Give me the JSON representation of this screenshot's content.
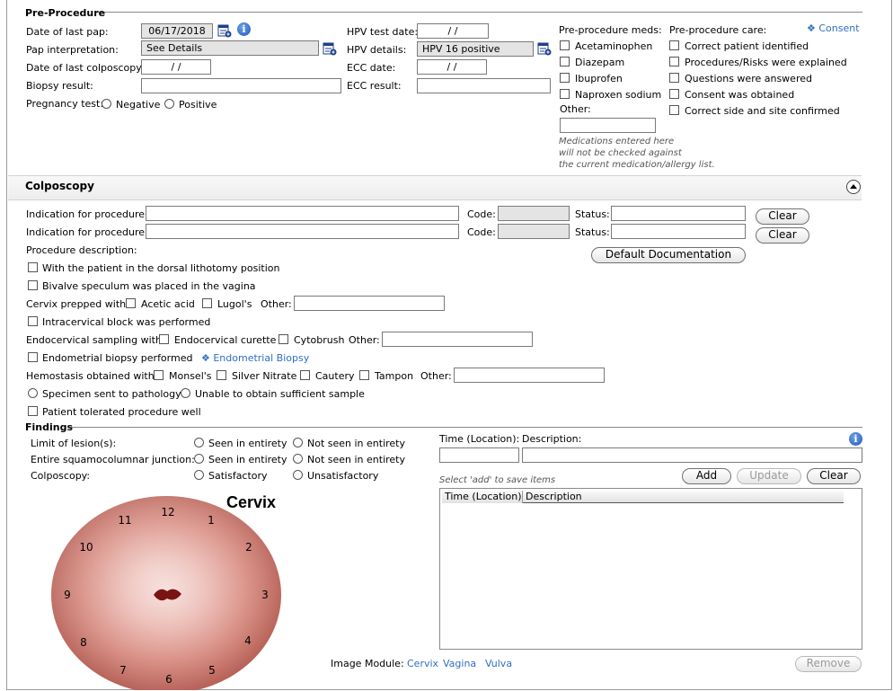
{
  "pre_procedure": {
    "title": "Pre-Procedure",
    "date_last_pap_label": "Date of last pap:",
    "date_last_pap_value": "06/17/2018",
    "pap_interp_label": "Pap interpretation:",
    "pap_interp_value": "See Details",
    "date_last_colpo_label": "Date of last colposcopy:",
    "date_last_colpo_value": "/ /",
    "biopsy_result_label": "Biopsy result:",
    "biopsy_result_value": "",
    "pregnancy_test_label": "Pregnancy test:",
    "negative_label": "Negative",
    "positive_label": "Positive",
    "hpv_test_date_label": "HPV test date:",
    "hpv_test_date_value": "/ /",
    "hpv_details_label": "HPV details:",
    "hpv_details_value": "HPV 16 positive",
    "ecc_date_label": "ECC date:",
    "ecc_date_value": "/ /",
    "ecc_result_label": "ECC result:",
    "ecc_result_value": "",
    "meds_label": "Pre-procedure meds:",
    "meds": [
      "Acetaminophen",
      "Diazepam",
      "Ibuprofen",
      "Naproxen sodium"
    ],
    "other_label": "Other:",
    "other_value": "",
    "meds_note": "Medications entered here\nwill not be checked against\nthe current medication/allergy list.",
    "care_label": "Pre-procedure care:",
    "consent_link": "Consent",
    "care": [
      "Correct patient identified",
      "Procedures/Risks were explained",
      "Questions were answered",
      "Consent was obtained",
      "Correct side and site confirmed"
    ]
  },
  "colposcopy": {
    "title": "Colposcopy",
    "indication_label": "Indication for procedure:",
    "code_label": "Code:",
    "status_label": "Status:",
    "clear_label": "Clear",
    "procedure_description_label": "Procedure description:",
    "default_doc_label": "Default Documentation",
    "dorsal": "With the patient in the dorsal lithotomy position",
    "bivalve": "Bivalve speculum was placed in the vagina",
    "cervix_prepped_label": "Cervix prepped with:",
    "acetic": "Acetic acid",
    "lugols": "Lugol's",
    "other_label": "Other:",
    "intracervical": "Intracervical block was performed",
    "endo_sampling_label": "Endocervical sampling with:",
    "endo_curette": "Endocervical curette",
    "cytobrush": "Cytobrush",
    "endometrial_biopsy": "Endometrial biopsy performed",
    "endometrial_link": "Endometrial Biopsy",
    "hemostasis_label": "Hemostasis obtained with:",
    "monsels": "Monsel's",
    "silver_nitrate": "Silver Nitrate",
    "cautery": "Cautery",
    "tampon": "Tampon",
    "specimen": "Specimen sent to pathology",
    "unable": "Unable to obtain sufficient sample",
    "tolerated": "Patient tolerated procedure well"
  },
  "findings": {
    "title": "Findings",
    "limit_label": "Limit of lesion(s):",
    "squamo_label": "Entire squamocolumnar junction:",
    "colposcopy_label": "Colposcopy:",
    "seen": "Seen in entirety",
    "not_seen": "Not seen in entirety",
    "satisfactory": "Satisfactory",
    "unsatisfactory": "Unsatisfactory",
    "time_location_label": "Time (Location):",
    "description_label": "Description:",
    "hint": "Select 'add' to save items",
    "add_label": "Add",
    "update_label": "Update",
    "clear_label": "Clear",
    "col_time": "Time (Location)",
    "col_desc": "Description",
    "remove_label": "Remove",
    "image_module_label": "Image Module:",
    "image_links": [
      "Cervix",
      "Vagina",
      "Vulva"
    ],
    "cervix_title": "Cervix",
    "clock": [
      "12",
      "1",
      "2",
      "3",
      "4",
      "5",
      "6",
      "7",
      "8",
      "9",
      "10",
      "11"
    ]
  },
  "colors": {
    "link": "#2f6fc4",
    "info": "#1e56b8"
  },
  "icons": [
    "calendar-edit-icon",
    "info-icon",
    "collapse-icon",
    "diamond-icon"
  ]
}
